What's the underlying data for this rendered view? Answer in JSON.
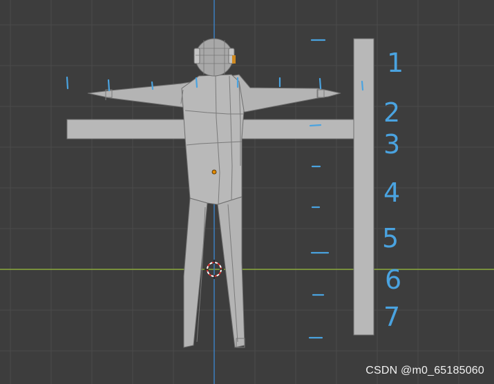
{
  "viewport": {
    "background": "#3d3d3d",
    "grid_color": "#4a4a4a",
    "x_axis_color": "#8cab3c",
    "y_axis_color": "#3c7fc0",
    "mesh_color": "#b8b8b8",
    "annotation_color": "#4aa3e0",
    "origin_dot_color": "#e08a00"
  },
  "annotations": {
    "numbers": [
      "1",
      "2",
      "3",
      "4",
      "5",
      "6",
      "7"
    ]
  },
  "watermark": {
    "text": "CSDN @m0_65185060"
  },
  "objects": {
    "character": "low-poly T-pose mesh",
    "reference_plane": "T-shaped measuring bar",
    "cursor": "3d-cursor-icon"
  }
}
